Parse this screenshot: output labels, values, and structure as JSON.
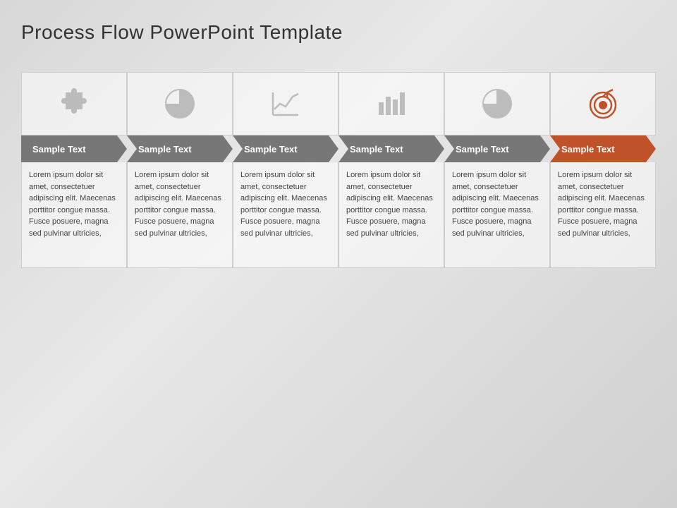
{
  "title": "Process Flow PowerPoint Template",
  "steps": [
    {
      "id": 1,
      "label": "Sample Text",
      "icon": "puzzle",
      "isOrange": false,
      "description": "Lorem ipsum dolor sit amet, consectetuer adipiscing elit. Maecenas porttitor congue massa. Fusce posuere, magna sed pulvinar ultricies,"
    },
    {
      "id": 2,
      "label": "Sample Text",
      "icon": "piechart",
      "isOrange": false,
      "description": "Lorem ipsum dolor sit amet, consectetuer adipiscing elit. Maecenas porttitor congue massa. Fusce posuere, magna sed pulvinar ultricies,"
    },
    {
      "id": 3,
      "label": "Sample Text",
      "icon": "linechart",
      "isOrange": false,
      "description": "Lorem ipsum dolor sit amet, consectetuer adipiscing elit. Maecenas porttitor congue massa. Fusce posuere, magna sed pulvinar ultricies,"
    },
    {
      "id": 4,
      "label": "Sample Text",
      "icon": "barchart",
      "isOrange": false,
      "description": "Lorem ipsum dolor sit amet, consectetuer adipiscing elit. Maecenas porttitor congue massa. Fusce posuere, magna sed pulvinar ultricies,"
    },
    {
      "id": 5,
      "label": "Sample Text",
      "icon": "piechart2",
      "isOrange": false,
      "description": "Lorem ipsum dolor sit amet, consectetuer adipiscing elit. Maecenas porttitor congue massa. Fusce posuere, magna sed pulvinar ultricies,"
    },
    {
      "id": 6,
      "label": "Sample Text",
      "icon": "target",
      "isOrange": true,
      "description": "Lorem ipsum dolor sit amet, consectetuer adipiscing elit. Maecenas porttitor congue massa. Fusce posuere, magna sed pulvinar ultricies,"
    }
  ]
}
